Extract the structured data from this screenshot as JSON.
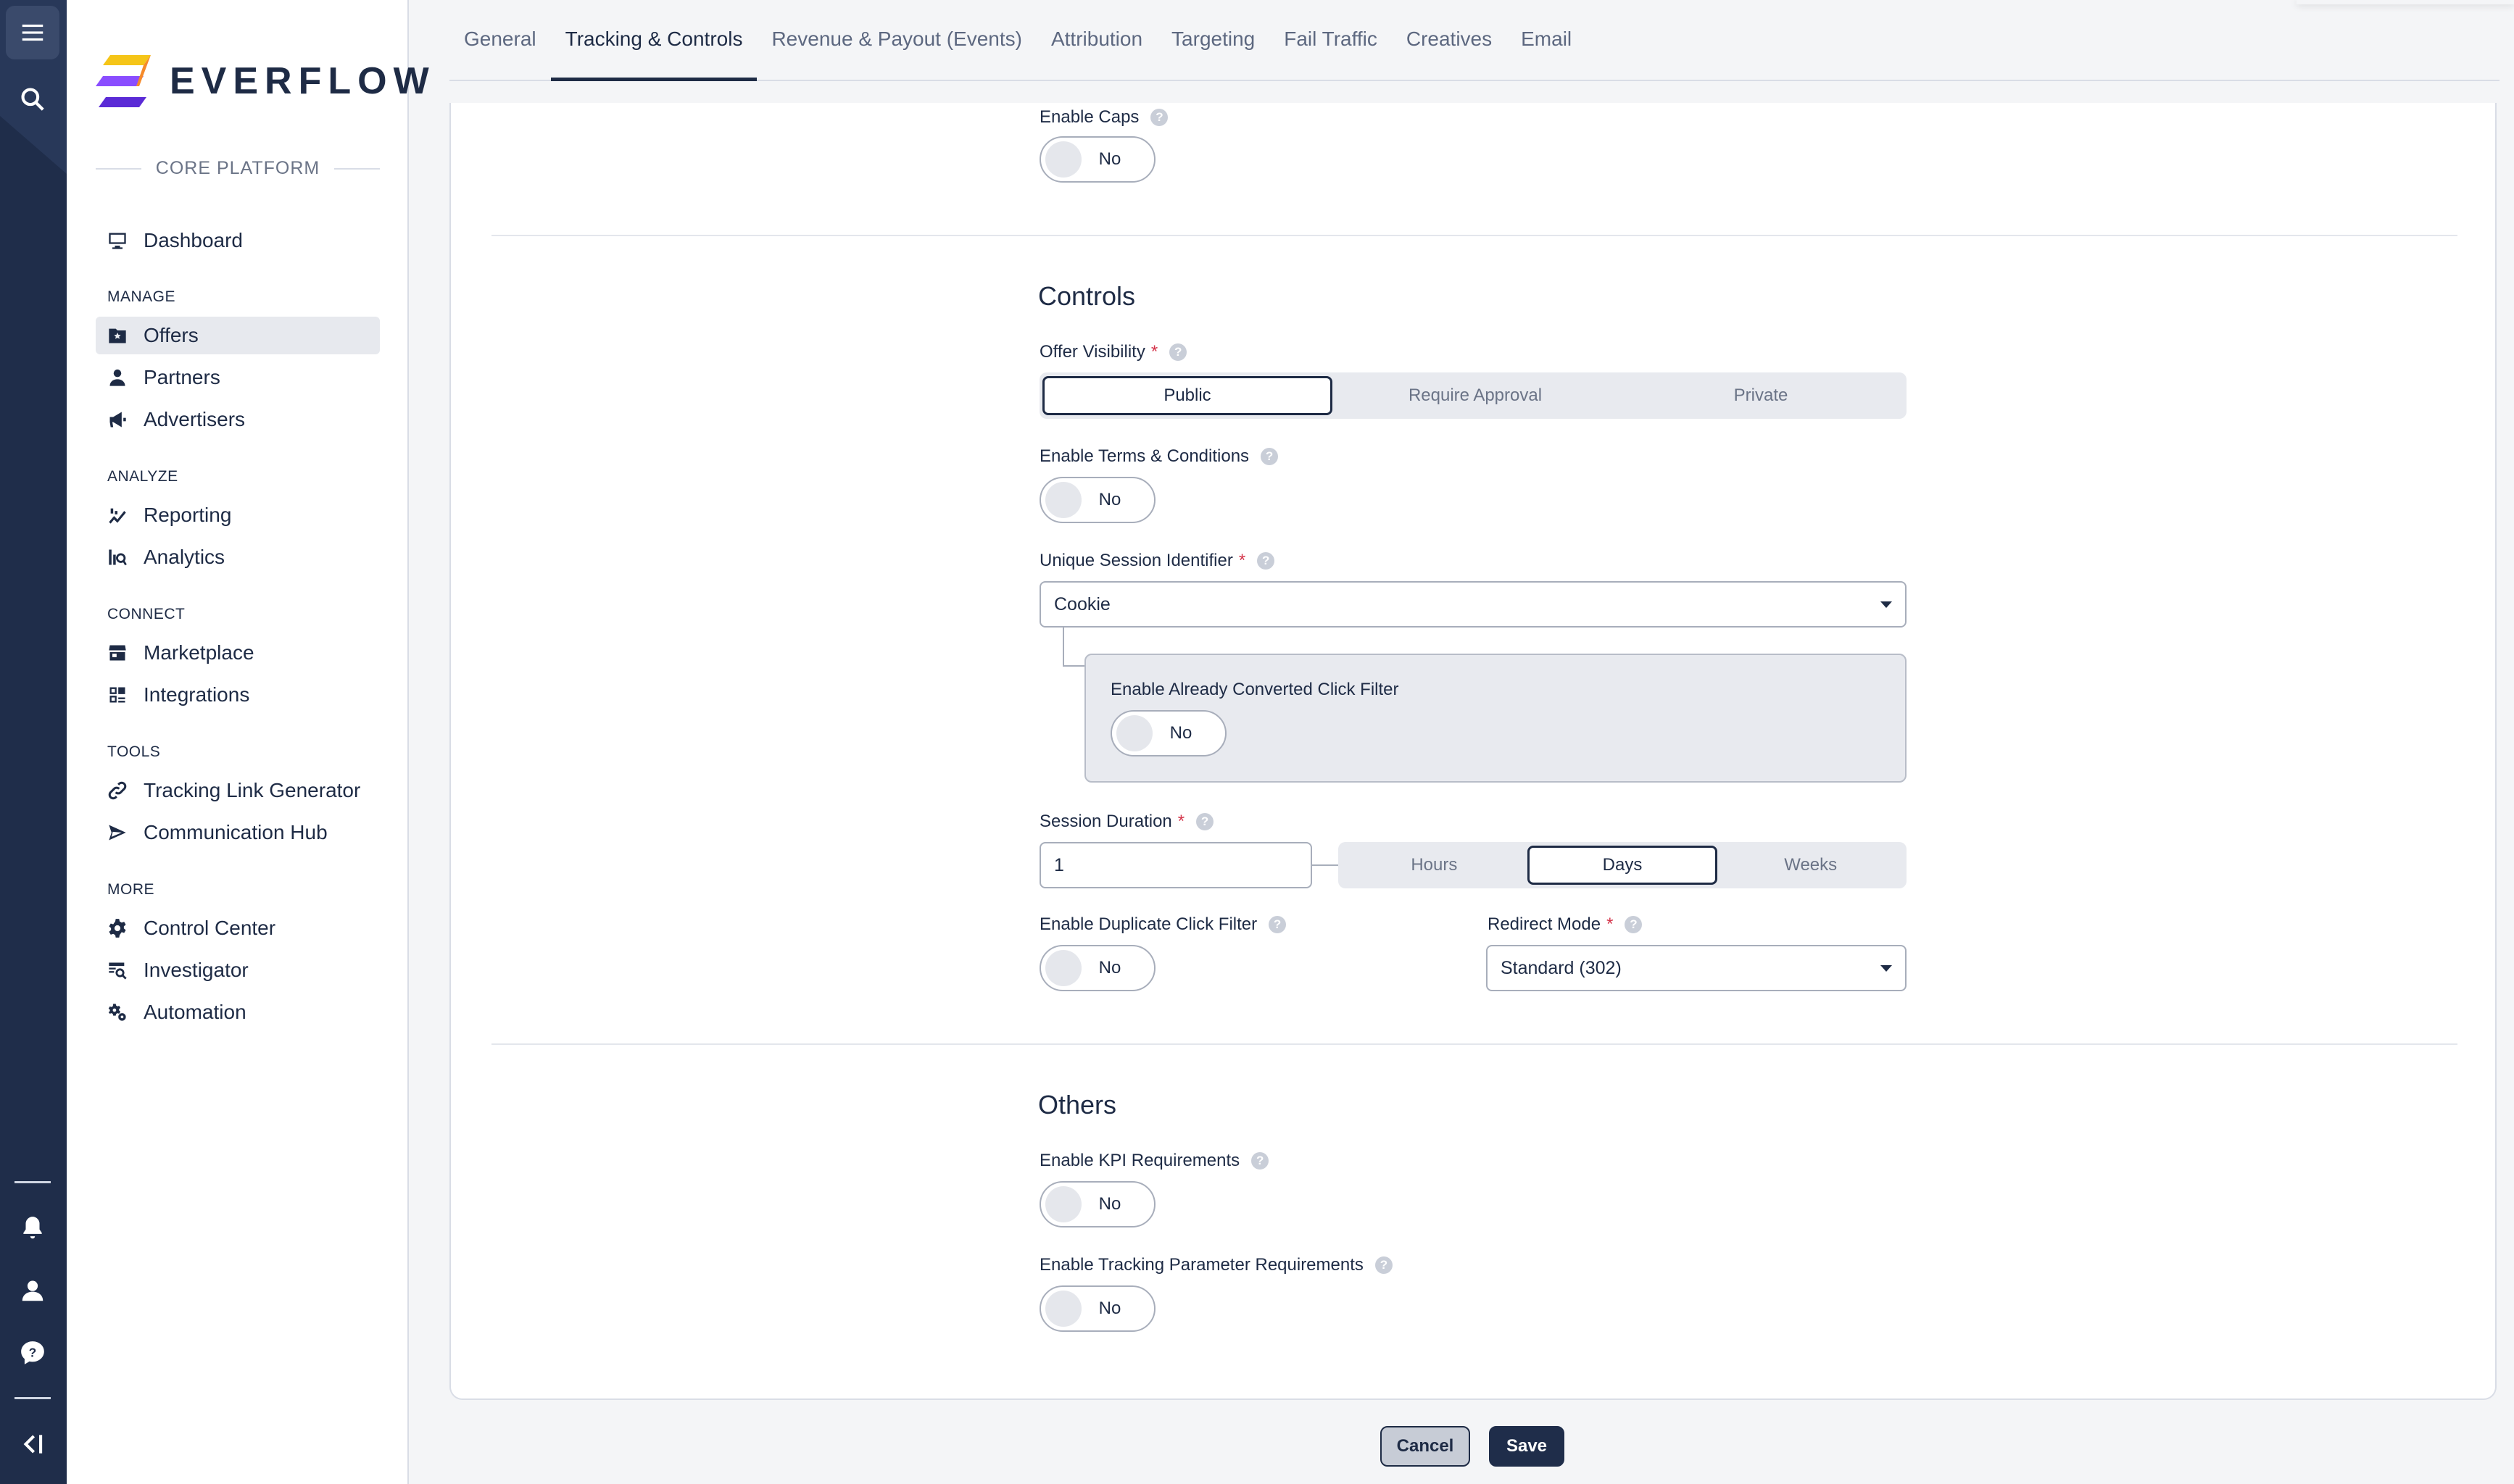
{
  "brand": {
    "name": "EVERFLOW",
    "platform": "CORE PLATFORM"
  },
  "nav": {
    "dashboard": "Dashboard",
    "manage_label": "MANAGE",
    "offers": "Offers",
    "partners": "Partners",
    "advertisers": "Advertisers",
    "analyze_label": "ANALYZE",
    "reporting": "Reporting",
    "analytics": "Analytics",
    "connect_label": "CONNECT",
    "marketplace": "Marketplace",
    "integrations": "Integrations",
    "tools_label": "TOOLS",
    "tracking_link_generator": "Tracking Link Generator",
    "communication_hub": "Communication Hub",
    "more_label": "MORE",
    "control_center": "Control Center",
    "investigator": "Investigator",
    "automation": "Automation",
    "active": "Offers"
  },
  "tabs": [
    {
      "label": "General"
    },
    {
      "label": "Tracking & Controls",
      "active": true
    },
    {
      "label": "Revenue & Payout (Events)"
    },
    {
      "label": "Attribution"
    },
    {
      "label": "Targeting"
    },
    {
      "label": "Fail Traffic"
    },
    {
      "label": "Creatives"
    },
    {
      "label": "Email"
    }
  ],
  "caps": {
    "label": "Enable Caps",
    "value": "No"
  },
  "controls": {
    "title": "Controls",
    "offer_visibility": {
      "label": "Offer Visibility",
      "options": [
        "Public",
        "Require Approval",
        "Private"
      ],
      "selected": "Public"
    },
    "terms": {
      "label": "Enable Terms & Conditions",
      "value": "No"
    },
    "session_identifier": {
      "label": "Unique Session Identifier",
      "value": "Cookie"
    },
    "converted_click_filter": {
      "label": "Enable Already Converted Click Filter",
      "value": "No"
    },
    "session_duration": {
      "label": "Session Duration",
      "value": "1",
      "units": [
        "Hours",
        "Days",
        "Weeks"
      ],
      "selected_unit": "Days"
    },
    "duplicate_click_filter": {
      "label": "Enable Duplicate Click Filter",
      "value": "No"
    },
    "redirect_mode": {
      "label": "Redirect Mode",
      "value": "Standard (302)"
    }
  },
  "others": {
    "title": "Others",
    "kpi": {
      "label": "Enable KPI Requirements",
      "value": "No"
    },
    "tracking_params": {
      "label": "Enable Tracking Parameter Requirements",
      "value": "No"
    }
  },
  "footer": {
    "cancel_label": "Cancel",
    "save_label": "Save"
  },
  "help_glyph": "?",
  "required_mark": "*",
  "colors": {
    "navy": "#1f2d4a",
    "brand_yellow": "#f5c518",
    "brand_purple": "#5b2bd6",
    "required": "#d4344a"
  }
}
